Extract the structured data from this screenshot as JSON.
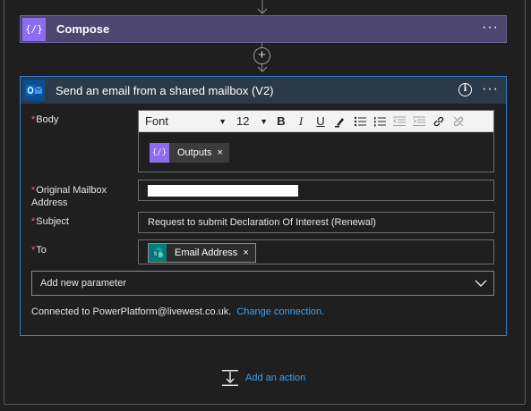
{
  "compose": {
    "title": "Compose",
    "icon": "expression-icon",
    "icon_text": "{/}",
    "more": "···",
    "color": "#8c6cf0"
  },
  "connector": {
    "add_symbol": "+"
  },
  "action": {
    "title": "Send an email from a shared mailbox (V2)",
    "icon": "outlook-icon",
    "info": "i",
    "more": "···",
    "accent": "#2f7fd3",
    "fields": {
      "body": {
        "label": "Body",
        "required_mark": "*",
        "toolbar": {
          "font": "Font",
          "size": "12",
          "bold": "B",
          "italic": "I",
          "underline": "U"
        },
        "token": {
          "label": "Outputs",
          "remove": "×",
          "icon": "expression-icon",
          "icon_text": "{/}"
        }
      },
      "original_mailbox": {
        "label_line1": "Original Mailbox",
        "label_line2": "Address",
        "required_mark": "*",
        "value_redacted": true
      },
      "subject": {
        "label": "Subject",
        "required_mark": "*",
        "value": "Request to submit Declaration Of Interest (Renewal)"
      },
      "to": {
        "label": "To",
        "required_mark": "*",
        "token": {
          "label": "Email Address",
          "remove": "×",
          "icon": "sharepoint-icon"
        }
      }
    },
    "add_parameter": "Add new parameter",
    "connection": {
      "text": "Connected to PowerPlatform@livewest.co.uk.",
      "link": "Change connection."
    }
  },
  "add_action": {
    "label": "Add an action",
    "icon": "insert-step-icon"
  },
  "colors": {
    "background": "#1f1f1f",
    "required": "#e06c6c",
    "link": "#3aa0f3",
    "compose_header": "#4c4670",
    "action_header": "#2a3a48"
  }
}
